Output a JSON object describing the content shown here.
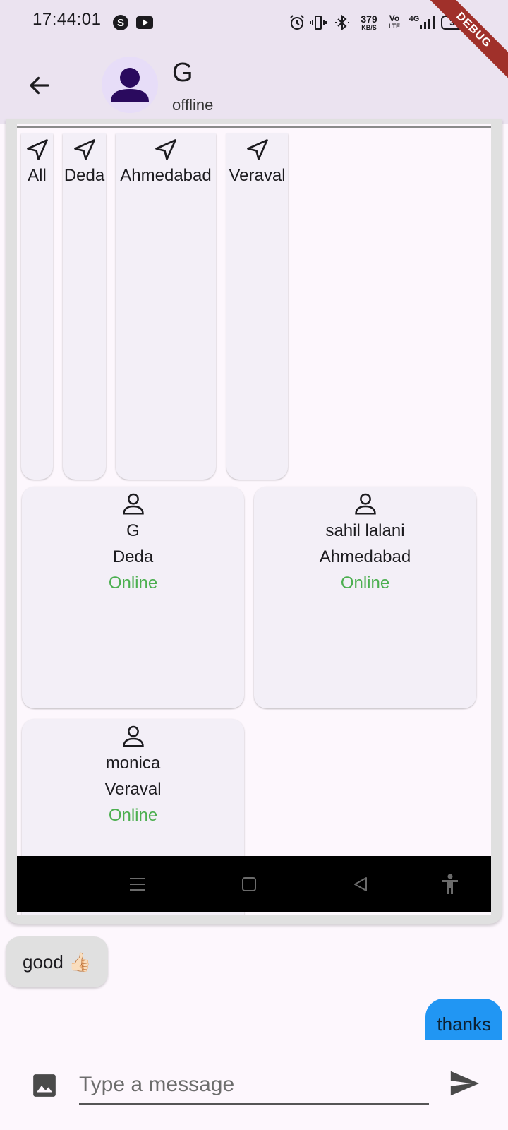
{
  "status_bar": {
    "time": "17:44:01",
    "net_speed_value": "379",
    "net_speed_unit": "KB/S",
    "volte_top": "Vo",
    "volte_bottom": "LTE",
    "network": "4G",
    "battery": "38",
    "debug_banner": "DEBUG",
    "icons": [
      "skype-icon",
      "youtube-icon",
      "alarm-icon",
      "vibrate-icon",
      "bluetooth-icon",
      "signal-icon",
      "battery-icon"
    ]
  },
  "app_bar": {
    "back_icon": "arrow-left-icon",
    "avatar_icon": "person-icon",
    "title": "G",
    "status": "offline"
  },
  "shared_screenshot": {
    "locations": [
      {
        "label": "All",
        "icon": "navigation-arrow-icon"
      },
      {
        "label": "Deda",
        "icon": "navigation-arrow-icon"
      },
      {
        "label": "Ahmedabad",
        "icon": "navigation-arrow-icon"
      },
      {
        "label": "Veraval",
        "icon": "navigation-arrow-icon"
      }
    ],
    "users": [
      {
        "name": "G",
        "location": "Deda",
        "status": "Online"
      },
      {
        "name": "sahil lalani",
        "location": "Ahmedabad",
        "status": "Online"
      },
      {
        "name": "monica",
        "location": "Veraval",
        "status": "Online"
      }
    ],
    "nav_icons": [
      "menu-icon",
      "home-square-icon",
      "back-triangle-icon",
      "accessibility-icon"
    ]
  },
  "messages": [
    {
      "direction": "incoming",
      "text": "good 👍🏻"
    },
    {
      "direction": "outgoing",
      "text": "thanks"
    }
  ],
  "composer": {
    "placeholder": "Type a message",
    "value": "",
    "image_icon": "image-icon",
    "send_icon": "send-icon"
  },
  "colors": {
    "app_bar_bg": "#ebe3f0",
    "page_bg": "#fdf7fd",
    "online_green": "#4caf50",
    "outgoing_bubble": "#2196f3",
    "incoming_bubble": "#e0e0e0",
    "avatar_bg": "#e7ddf8",
    "avatar_fg": "#2a0a5e"
  }
}
